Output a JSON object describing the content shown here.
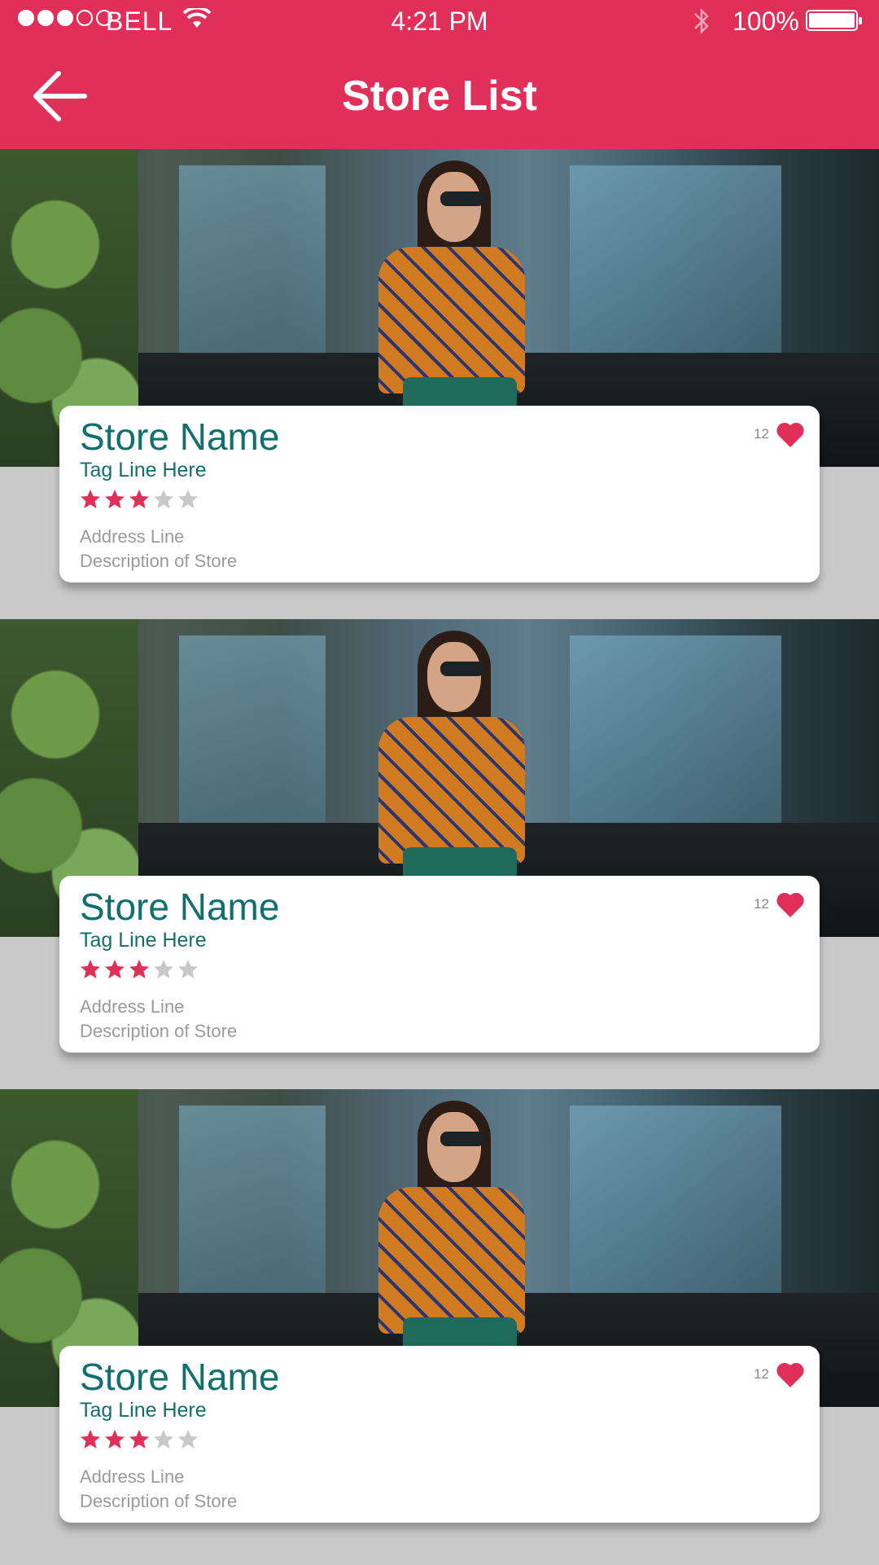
{
  "status_bar": {
    "carrier": "BELL",
    "time": "4:21 PM",
    "battery": "100%",
    "battery_level": 1.0,
    "signal_bars_filled": 3,
    "signal_bars_total": 5
  },
  "header": {
    "title": "Store List",
    "back_icon": "arrow-left-icon"
  },
  "colors": {
    "accent": "#e0305a",
    "store_name": "#126f6f",
    "star_filled": "#e0305a",
    "star_empty": "#c8c8c8",
    "muted_text": "#9a9a9a"
  },
  "stores": [
    {
      "name": "Store Name",
      "tagline": "Tag Line Here",
      "rating": 3,
      "rating_max": 5,
      "address": "Address Line",
      "description": "Description of Store",
      "likes": "12"
    },
    {
      "name": "Store Name",
      "tagline": "Tag Line Here",
      "rating": 3,
      "rating_max": 5,
      "address": "Address Line",
      "description": "Description of Store",
      "likes": "12"
    },
    {
      "name": "Store Name",
      "tagline": "Tag Line Here",
      "rating": 3,
      "rating_max": 5,
      "address": "Address Line",
      "description": "Description of Store",
      "likes": "12"
    }
  ]
}
